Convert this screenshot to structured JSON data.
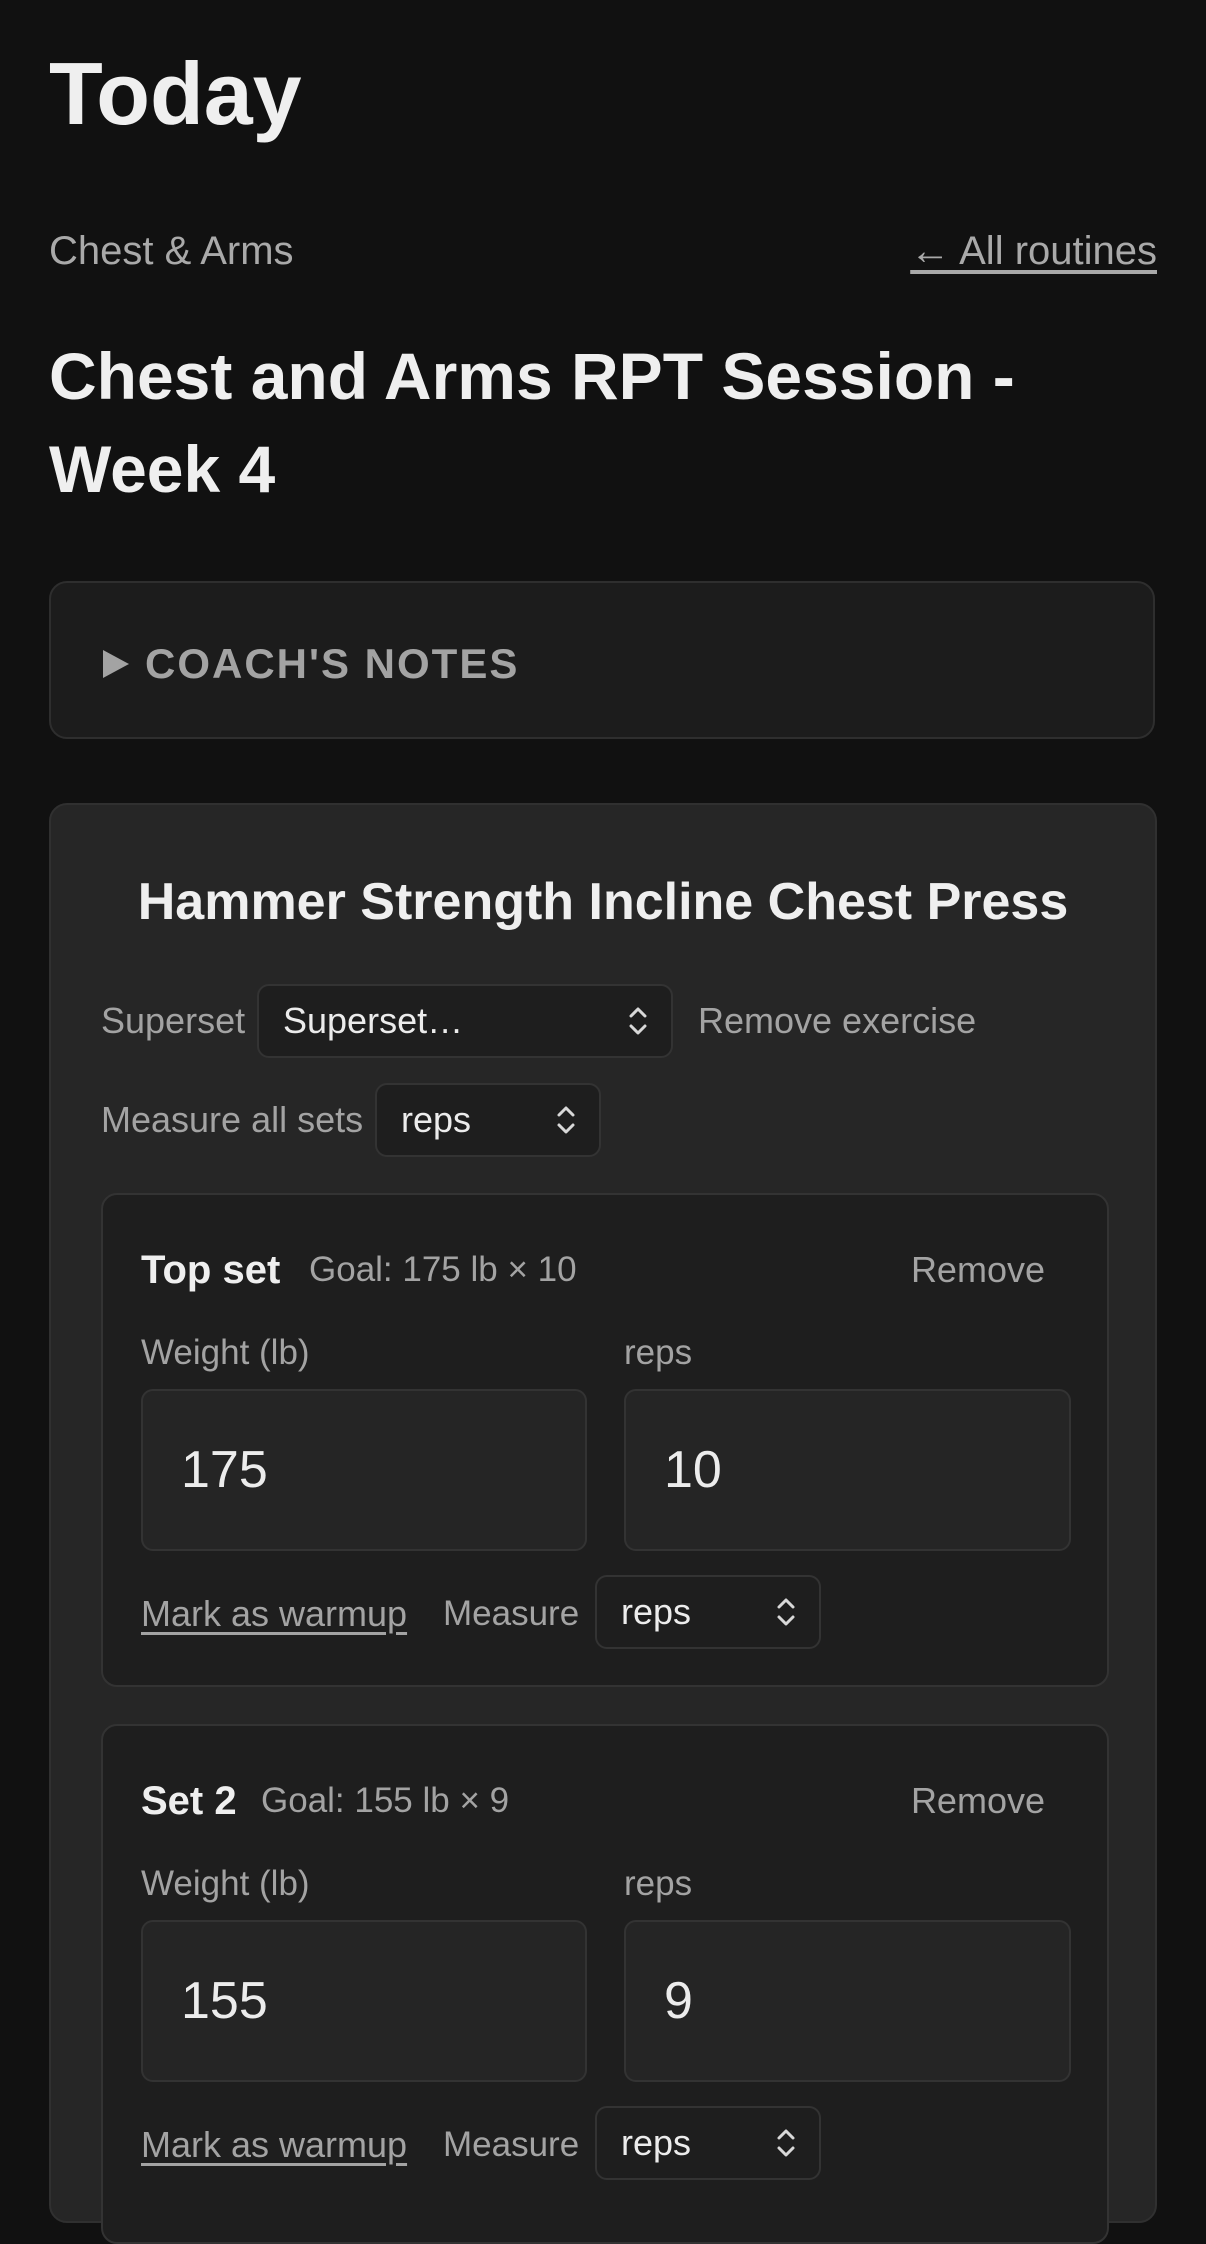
{
  "header": {
    "title": "Today",
    "routine_name": "Chest & Arms",
    "all_routines_link": "← All routines",
    "session_title": "Chest and Arms RPT Session - Week 4"
  },
  "notes": {
    "label": "COACH'S NOTES"
  },
  "exercise": {
    "title": "Hammer Strength Incline Chest Press",
    "superset_label": "Superset",
    "superset_value": "Superset…",
    "remove_exercise": "Remove exercise",
    "measure_all_label": "Measure all sets",
    "measure_all_value": "reps",
    "sets": [
      {
        "name": "Top set",
        "goal": "Goal: 175 lb × 10",
        "remove": "Remove",
        "weight_label": "Weight (lb)",
        "weight": "175",
        "reps_label": "reps",
        "reps": "10",
        "warmup": "Mark as warmup",
        "measure_label": "Measure",
        "measure_value": "reps"
      },
      {
        "name": "Set 2",
        "goal": "Goal: 155 lb × 9",
        "remove": "Remove",
        "weight_label": "Weight (lb)",
        "weight": "155",
        "reps_label": "reps",
        "reps": "9",
        "warmup": "Mark as warmup",
        "measure_label": "Measure",
        "measure_value": "reps"
      }
    ]
  }
}
